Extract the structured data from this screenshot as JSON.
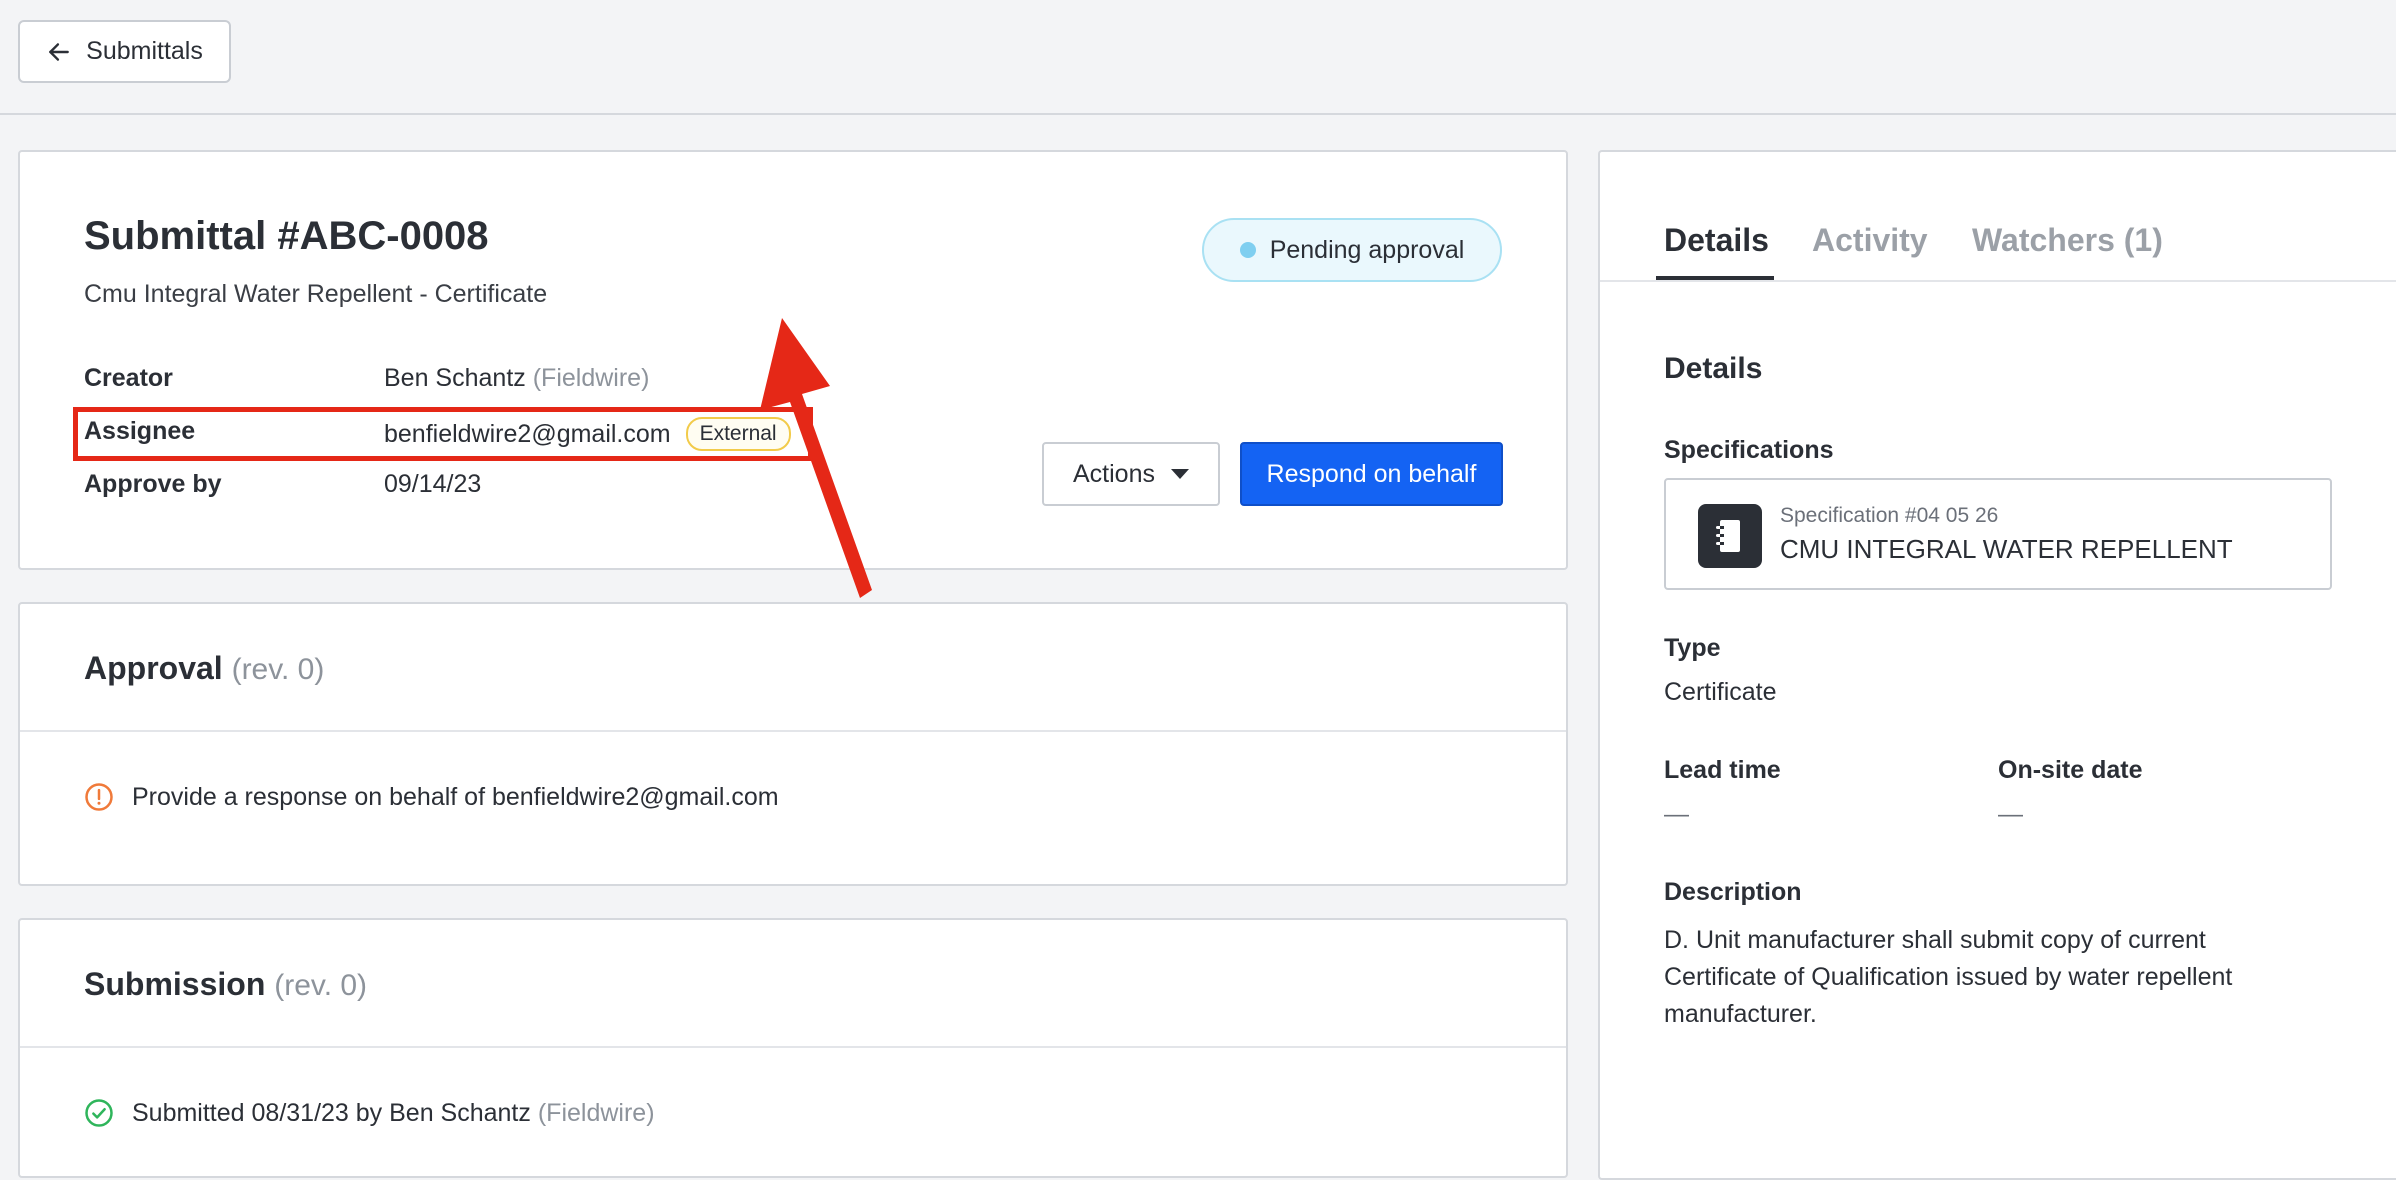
{
  "topbar": {
    "back_label": "Submittals"
  },
  "submittal": {
    "title": "Submittal #ABC-0008",
    "subtitle": "Cmu Integral Water Repellent - Certificate",
    "status": "Pending approval",
    "fields": {
      "creator_label": "Creator",
      "creator_name": "Ben Schantz",
      "creator_org": "(Fieldwire)",
      "assignee_label": "Assignee",
      "assignee_email": "benfieldwire2@gmail.com",
      "assignee_badge": "External",
      "approve_label": "Approve by",
      "approve_date": "09/14/23"
    },
    "actions_label": "Actions",
    "respond_label": "Respond on behalf"
  },
  "approval": {
    "title": "Approval",
    "rev": "(rev. 0)",
    "notice": "Provide a response on behalf of benfieldwire2@gmail.com"
  },
  "submission": {
    "title": "Submission",
    "rev": "(rev. 0)",
    "notice_text": "Submitted 08/31/23 by Ben Schantz",
    "notice_org": "(Fieldwire)"
  },
  "sidebar": {
    "tabs": [
      {
        "label": "Details"
      },
      {
        "label": "Activity"
      },
      {
        "label": "Watchers (1)"
      }
    ],
    "heading": "Details",
    "specifications_label": "Specifications",
    "spec_number": "Specification #04 05 26",
    "spec_name": "CMU INTEGRAL WATER REPELLENT",
    "type_label": "Type",
    "type_value": "Certificate",
    "lead_time_label": "Lead time",
    "lead_time_value": "—",
    "onsite_label": "On-site date",
    "onsite_value": "—",
    "description_label": "Description",
    "description_value": "D. Unit manufacturer shall submit copy of current Certificate of Qualification issued by water repellent manufacturer."
  },
  "colors": {
    "primary": "#1463f3",
    "highlight": "#e52817",
    "status_dot": "#7fcff0",
    "warning": "#f07a3a",
    "success": "#2fb55b",
    "external_border": "#f2cb4a"
  },
  "icons": [
    "arrow-left-icon",
    "status-dot-icon",
    "caret-down-icon",
    "alert-circle-icon",
    "check-circle-icon",
    "notebook-icon",
    "pointer-arrow-icon"
  ]
}
